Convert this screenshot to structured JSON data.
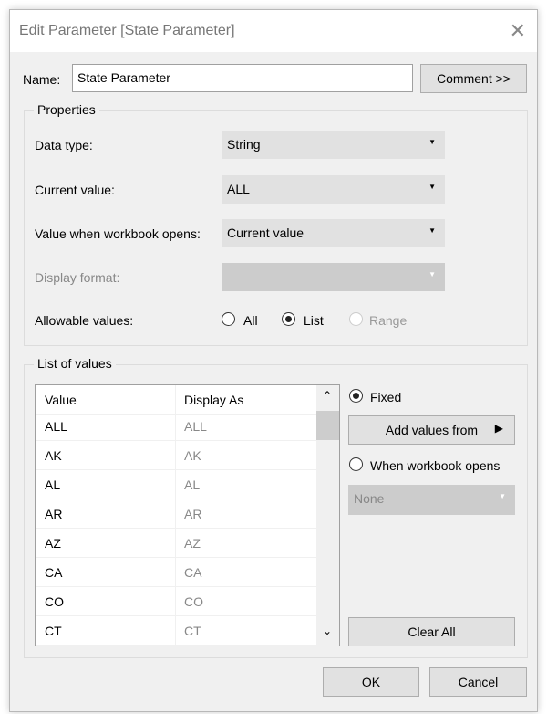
{
  "title": "Edit Parameter [State Parameter]",
  "name_label": "Name:",
  "name_value": "State Parameter",
  "comment_button": "Comment >>",
  "properties": {
    "legend": "Properties",
    "data_type_label": "Data type:",
    "data_type_value": "String",
    "current_value_label": "Current value:",
    "current_value_value": "ALL",
    "open_label": "Value when workbook opens:",
    "open_value": "Current value",
    "display_format_label": "Display format:",
    "display_format_value": "",
    "allowable_label": "Allowable values:",
    "allowable_options": [
      "All",
      "List",
      "Range"
    ],
    "allowable_selected": "List"
  },
  "list": {
    "legend": "List of values",
    "headers": [
      "Value",
      "Display As"
    ],
    "rows": [
      [
        "ALL",
        "ALL"
      ],
      [
        "AK",
        "AK"
      ],
      [
        "AL",
        "AL"
      ],
      [
        "AR",
        "AR"
      ],
      [
        "AZ",
        "AZ"
      ],
      [
        "CA",
        "CA"
      ],
      [
        "CO",
        "CO"
      ],
      [
        "CT",
        "CT"
      ]
    ],
    "fixed_label": "Fixed",
    "add_values_button": "Add values from",
    "when_opens_label": "When workbook opens",
    "when_opens_value": "None",
    "clear_all_button": "Clear All",
    "selected_mode": "Fixed"
  },
  "ok_button": "OK",
  "cancel_button": "Cancel"
}
